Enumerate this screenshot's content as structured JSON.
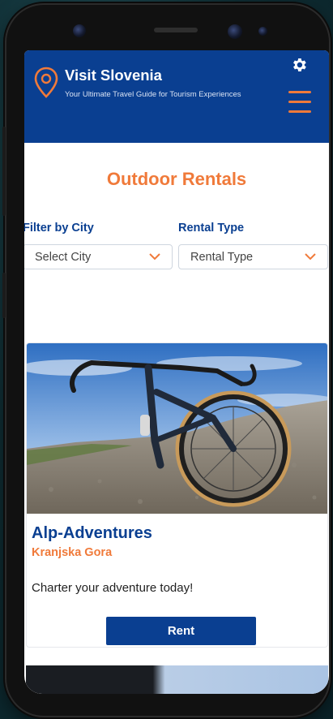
{
  "header": {
    "title": "Visit Slovenia",
    "tagline": "Your Ultimate Travel Guide for Tourism Experiences"
  },
  "page": {
    "title": "Outdoor Rentals"
  },
  "filters": {
    "city_label": "Filter by City",
    "city_value": "Select City",
    "type_label": "Rental Type",
    "type_value": "Rental Type"
  },
  "listings": [
    {
      "name": "Alp-Adventures",
      "location": "Kranjska Gora",
      "description": "Charter your adventure today!",
      "action_label": "Rent"
    }
  ],
  "colors": {
    "brand_blue": "#0a3f91",
    "accent_orange": "#f07a3a"
  },
  "icons": {
    "logo": "map-pin-icon",
    "settings": "gear-icon",
    "menu": "hamburger-menu-icon",
    "dropdown": "chevron-down-icon"
  }
}
